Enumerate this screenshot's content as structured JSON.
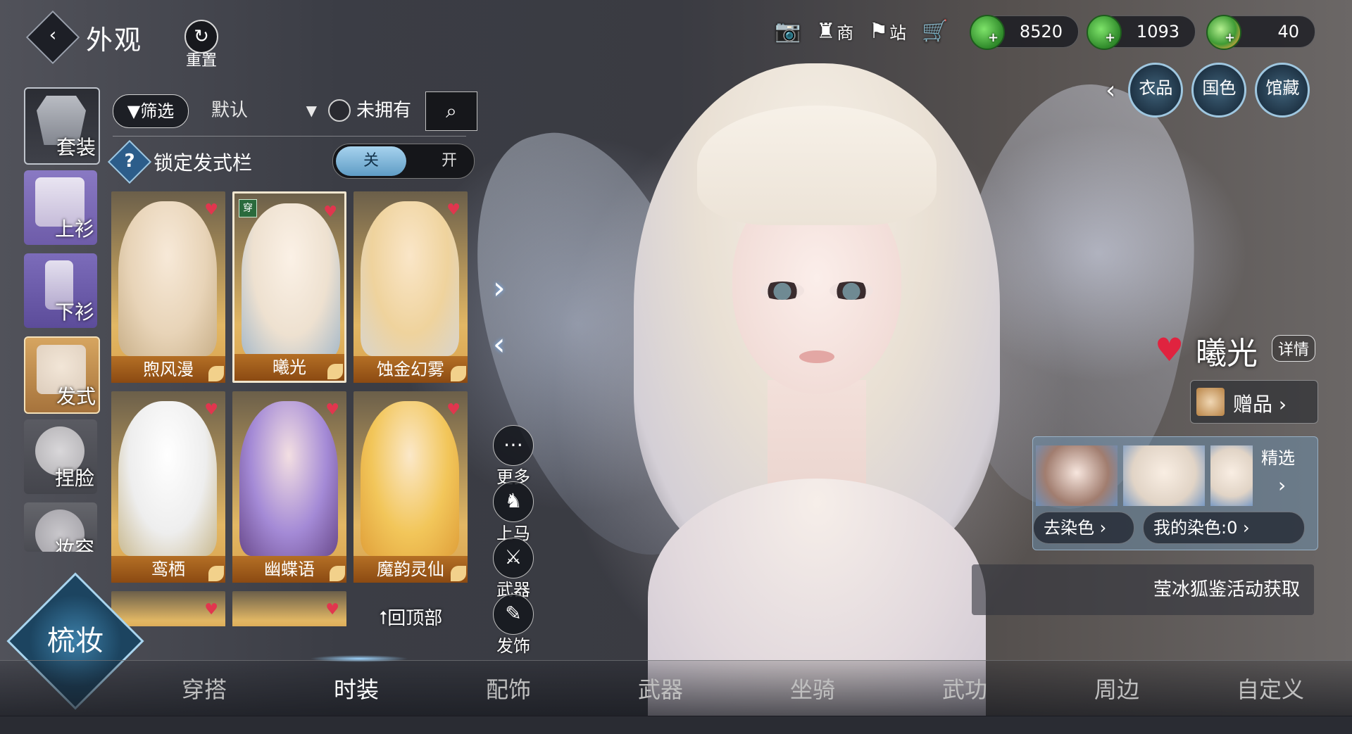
{
  "header": {
    "title": "外观",
    "reset_label": "重置"
  },
  "top_icons": {
    "shop": "商",
    "station": "站"
  },
  "currencies": [
    {
      "value": "8520"
    },
    {
      "value": "1093"
    },
    {
      "value": "40"
    }
  ],
  "top_tabs": [
    "衣品",
    "国色",
    "馆藏"
  ],
  "sidebar": {
    "items": [
      {
        "label": "套装"
      },
      {
        "label": "上衫"
      },
      {
        "label": "下衫"
      },
      {
        "label": "发式",
        "active": true
      },
      {
        "label": "捏脸"
      },
      {
        "label": "妆容"
      }
    ]
  },
  "filter": {
    "filter_label": "筛选",
    "sort_value": "默认",
    "not_owned_label": "未拥有"
  },
  "lock": {
    "label": "锁定发式栏",
    "off": "关",
    "on": "开"
  },
  "cards": [
    {
      "name": "煦风漫",
      "selected": false
    },
    {
      "name": "曦光",
      "selected": true,
      "badge": "穿"
    },
    {
      "name": "蚀金幻雾",
      "selected": false
    },
    {
      "name": "鸾栖",
      "selected": false
    },
    {
      "name": "幽蝶语",
      "selected": false
    },
    {
      "name": "魔韵灵仙",
      "selected": false
    }
  ],
  "back_to_top": "回顶部",
  "mid_buttons": [
    "更多",
    "上马",
    "武器",
    "发饰"
  ],
  "detail": {
    "name": "曦光",
    "detail_tag": "详情",
    "gift_label": "赠品",
    "featured_label": "精选",
    "go_dye": "去染色",
    "my_dye": "我的染色:0",
    "source": "莹冰狐鉴活动获取"
  },
  "bottom_nav": [
    "穿搭",
    "时装",
    "配饰",
    "武器",
    "坐骑",
    "武功",
    "周边",
    "自定义"
  ],
  "makeup_label": "梳妆",
  "colors": {
    "accent": "#9fc7e0",
    "card_name_bg": "#8b4a12",
    "heart": "#e1364e"
  }
}
